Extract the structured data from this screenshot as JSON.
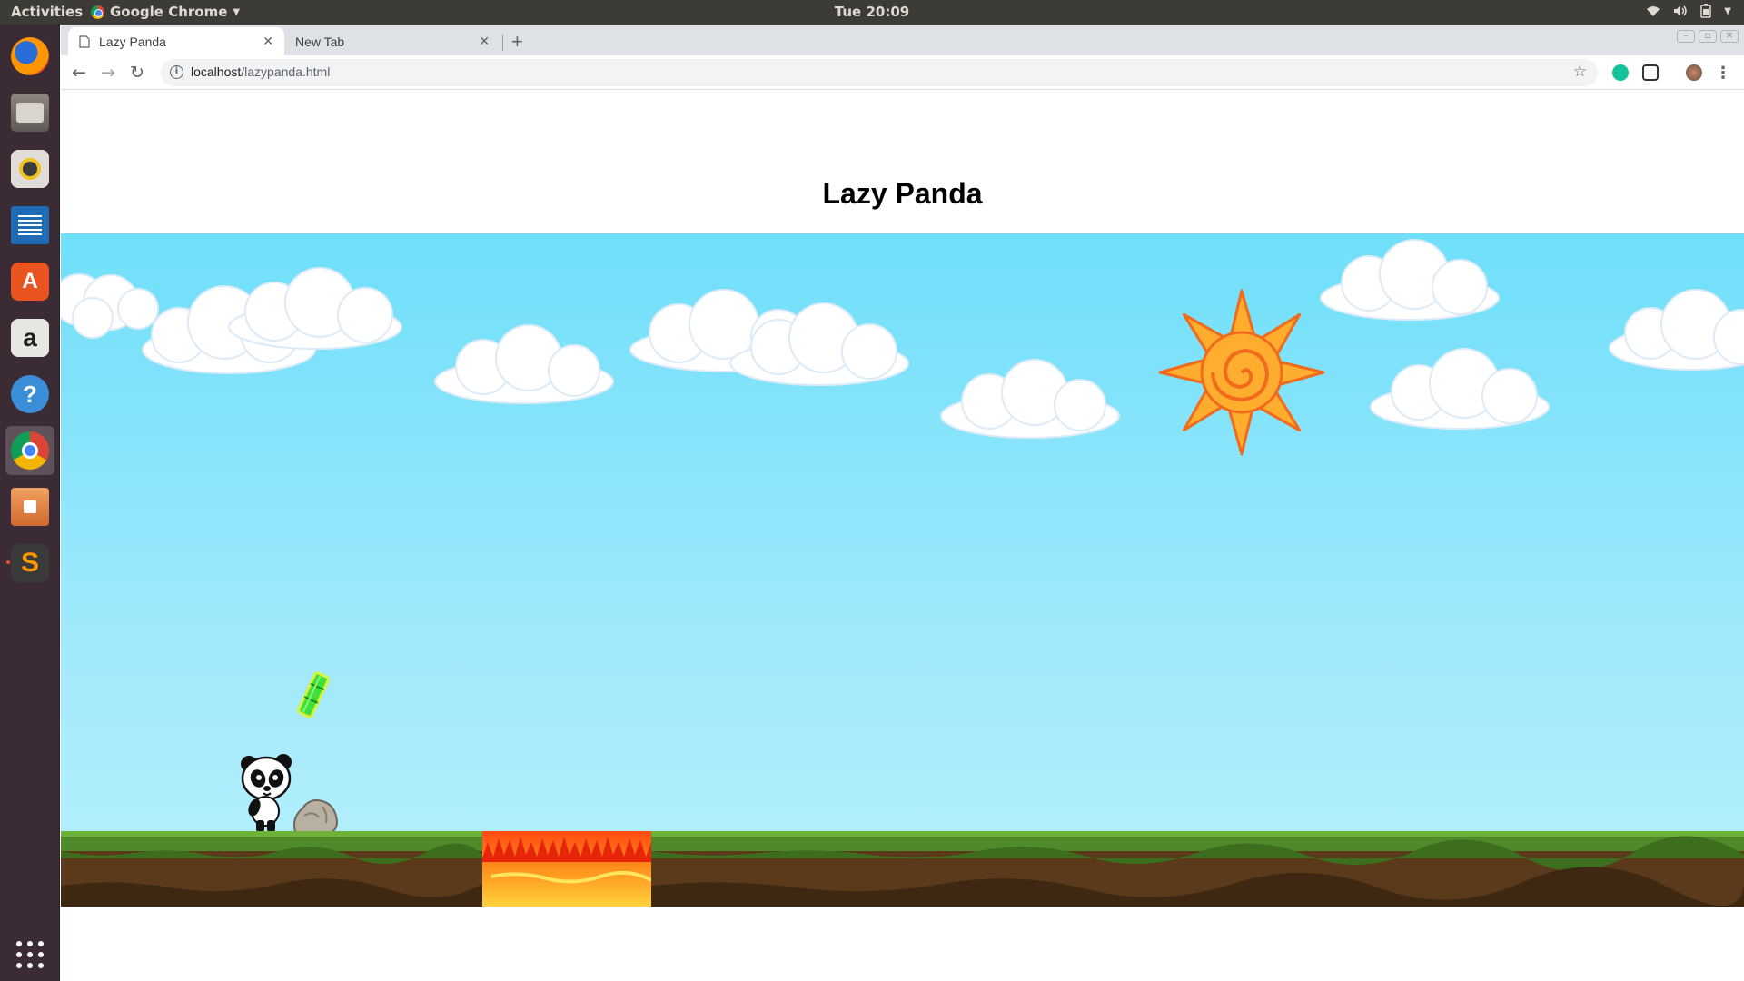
{
  "system_bar": {
    "activities": "Activities",
    "app_name": "Google Chrome",
    "clock": "Tue 20:09",
    "tray_icons": [
      "wifi-icon",
      "volume-icon",
      "battery-icon",
      "chevron-down-icon"
    ]
  },
  "dock": {
    "items": [
      "firefox",
      "files",
      "rhythmbox",
      "libreoffice-writer",
      "ubuntu-software",
      "amazon",
      "help",
      "google-chrome",
      "file-roller",
      "sublime-text"
    ],
    "active": "google-chrome"
  },
  "browser": {
    "tabs": [
      {
        "label": "Lazy Panda",
        "active": true
      },
      {
        "label": "New Tab",
        "active": false
      }
    ],
    "new_tab_symbol": "+",
    "url_host": "localhost",
    "url_path": "/lazypanda.html"
  },
  "page": {
    "title": "Lazy Panda"
  },
  "game": {
    "sprites": [
      "cloud",
      "sun",
      "bamboo",
      "panda",
      "rock",
      "grass-ground",
      "lava-pit"
    ],
    "colors": {
      "sky_top": "#6fdffa",
      "sky_bottom": "#b8f0fc",
      "grass": "#4e8a2a",
      "dirt": "#5a3a1a",
      "lava": "#f7a21b",
      "sun": "#ff9a1f"
    }
  }
}
